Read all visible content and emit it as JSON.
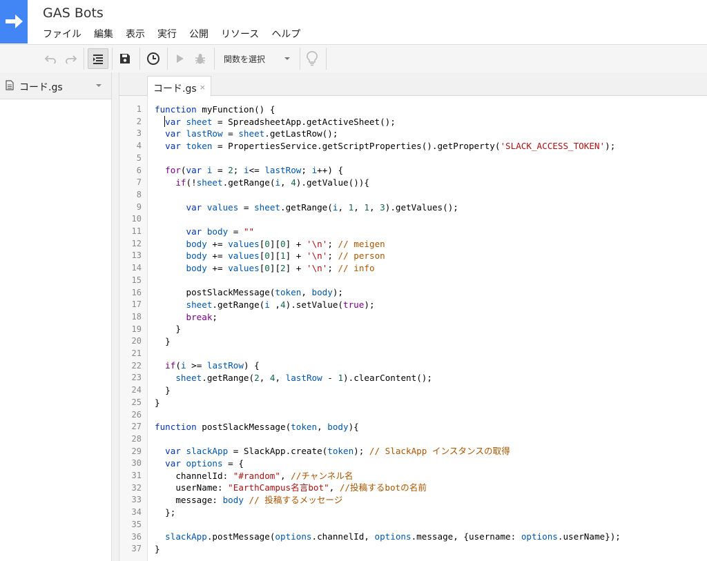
{
  "app": {
    "title": "GAS Bots"
  },
  "menu": [
    "ファイル",
    "編集",
    "表示",
    "実行",
    "公開",
    "リソース",
    "ヘルプ"
  ],
  "toolbar": {
    "function_select": "関数を選択"
  },
  "sidebar": {
    "file_name": "コード.gs"
  },
  "tabs": [
    {
      "label": "コード.gs",
      "close": "×"
    }
  ],
  "code_lines": [
    "function myFunction() {",
    "  var sheet = SpreadsheetApp.getActiveSheet();",
    "  var lastRow = sheet.getLastRow();",
    "  var token = PropertiesService.getScriptProperties().getProperty('SLACK_ACCESS_TOKEN');",
    "",
    "  for(var i = 2; i<= lastRow; i++) {",
    "    if(!sheet.getRange(i, 4).getValue()){",
    "",
    "      var values = sheet.getRange(i, 1, 1, 3).getValues();",
    "",
    "      var body = \"\"",
    "      body += values[0][0] + '\\n'; // meigen",
    "      body += values[0][1] + '\\n'; // person",
    "      body += values[0][2] + '\\n'; // info",
    "",
    "      postSlackMessage(token, body);",
    "      sheet.getRange(i ,4).setValue(true);",
    "      break;",
    "    }",
    "  }",
    "",
    "  if(i >= lastRow) {",
    "    sheet.getRange(2, 4, lastRow - 1).clearContent();",
    "  }",
    "}",
    "",
    "function postSlackMessage(token, body){",
    "",
    "  var slackApp = SlackApp.create(token); // SlackApp インスタンスの取得",
    "  var options = {",
    "    channelId: \"#random\", //チャンネル名",
    "    userName: \"EarthCampus名言bot\", //投稿するbotの名前",
    "    message: body // 投稿するメッセージ",
    "  };",
    "",
    "  slackApp.postMessage(options.channelId, options.message, {username: options.userName});",
    "}"
  ]
}
